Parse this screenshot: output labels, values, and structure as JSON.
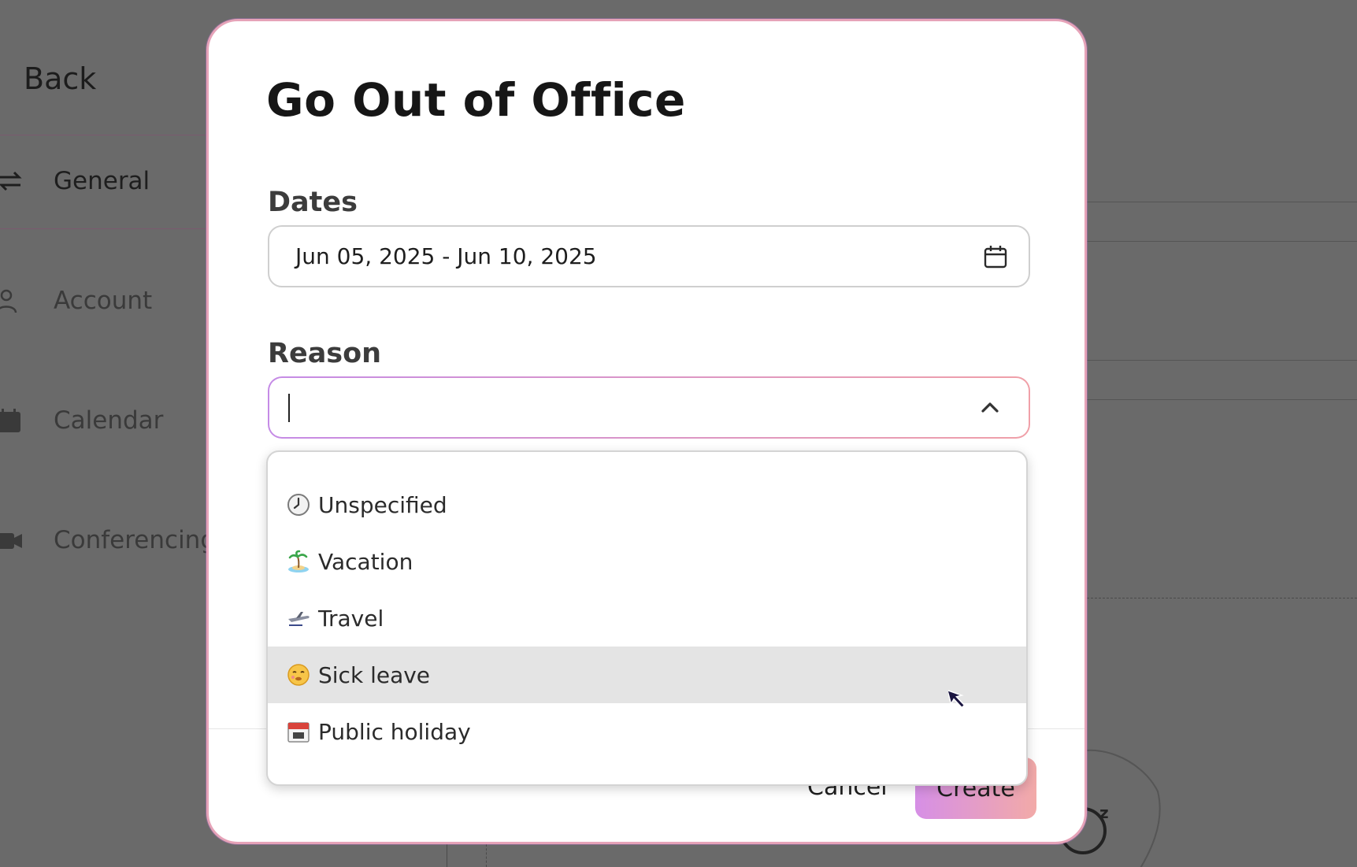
{
  "background": {
    "back_label": "Back",
    "nav": [
      {
        "label": "General",
        "icon": "repeat-icon"
      },
      {
        "label": "Account",
        "icon": "user-icon"
      },
      {
        "label": "Calendar",
        "icon": "calendar-icon"
      },
      {
        "label": "Conferencing",
        "icon": "video-icon"
      }
    ]
  },
  "modal": {
    "title": "Go Out of Office",
    "dates_label": "Dates",
    "dates_value": "Jun 05, 2025 - Jun 10, 2025",
    "reason_label": "Reason",
    "reason_value": "",
    "cancel_label": "Cancel",
    "create_label": "Create"
  },
  "dropdown": {
    "options": [
      {
        "label": "Unspecified",
        "icon": "clock-icon"
      },
      {
        "label": "Vacation",
        "icon": "island-icon"
      },
      {
        "label": "Travel",
        "icon": "airplane-icon"
      },
      {
        "label": "Sick leave",
        "icon": "sick-face-icon",
        "hovered": true
      },
      {
        "label": "Public holiday",
        "icon": "calendar-date-icon"
      }
    ]
  },
  "colors": {
    "overlay": "#666666",
    "accent_start": "#c58be6",
    "accent_end": "#f0a0a8",
    "hover_bg": "#e4e4e4"
  }
}
